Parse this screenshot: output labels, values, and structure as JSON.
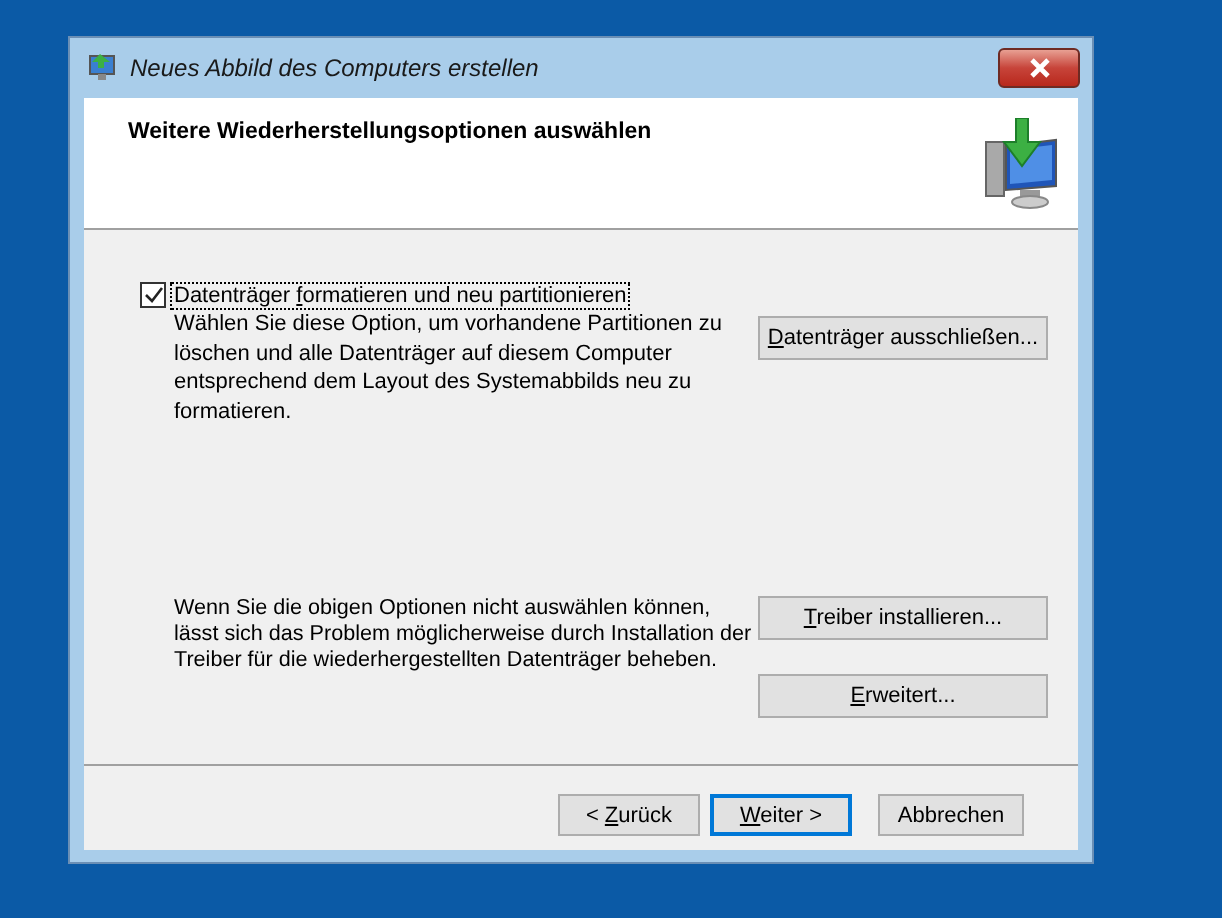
{
  "window": {
    "title": "Neues Abbild des Computers erstellen"
  },
  "header": {
    "heading": "Weitere Wiederherstellungsoptionen auswählen"
  },
  "format_option": {
    "checked": true,
    "label": {
      "pre": "Datenträger ",
      "key": "f",
      "post": "ormatieren und neu partitionieren"
    },
    "description": "Wählen Sie diese Option, um vorhandene Partitionen zu löschen und alle Datenträger auf diesem Computer entsprechend dem Layout des Systemabbilds neu zu formatieren.",
    "button": {
      "key": "D",
      "post": "atenträger ausschließen..."
    }
  },
  "driver_hint": {
    "text": "Wenn Sie die obigen Optionen nicht auswählen können, lässt sich das Problem möglicherweise durch Installation der Treiber für die wiederhergestellten Datenträger beheben.",
    "buttons": [
      {
        "key": "T",
        "post": "reiber installieren..."
      },
      {
        "key": "E",
        "post": "rweitert..."
      }
    ]
  },
  "footer_buttons": [
    {
      "pre": "< ",
      "key": "Z",
      "post": "urück",
      "default": false
    },
    {
      "key": "W",
      "post": "eiter >",
      "default": true
    },
    {
      "pre": "Abbrechen",
      "default": false
    }
  ]
}
